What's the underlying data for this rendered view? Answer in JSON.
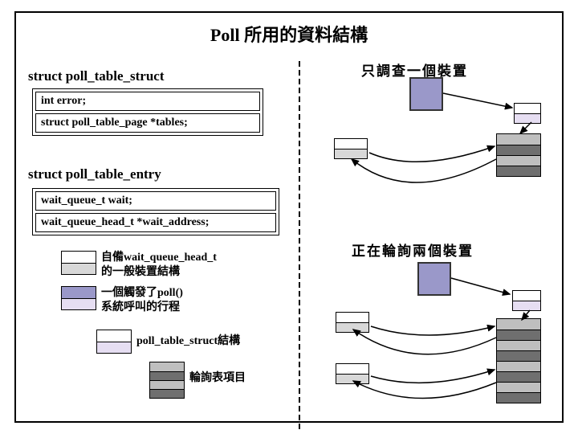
{
  "title": "Poll 所用的資料結構",
  "left": {
    "struct1_name": "struct poll_table_struct",
    "struct1_fields": [
      "int error;",
      "struct poll_table_page *tables;"
    ],
    "struct2_name": "struct poll_table_entry",
    "struct2_fields": [
      "wait_queue_t wait;",
      "wait_queue_head_t *wait_address;"
    ],
    "legend": [
      {
        "text_ln1": "自備wait_queue_head_t",
        "text_ln2": "的一般裝置結構",
        "colors": [
          "#ffffff",
          "#d8d8d8"
        ]
      },
      {
        "text_ln1": "一個觸發了poll()",
        "text_ln2": "系統呼叫的行程",
        "colors": [
          "#9a98c9",
          "#e6def2"
        ]
      },
      {
        "text_ln1": "poll_table_struct結構",
        "text_ln2": "",
        "colors": [
          "#ffffff",
          "#e6def2"
        ]
      },
      {
        "text_ln1": "輪詢表項目",
        "text_ln2": "",
        "colors": [
          "#bfbfbf",
          "#6f6f6f",
          "#bfbfbf",
          "#6f6f6f"
        ]
      }
    ]
  },
  "right": {
    "label_single": "只調查一個裝置",
    "label_multi": "正在輪詢兩個裝置"
  }
}
